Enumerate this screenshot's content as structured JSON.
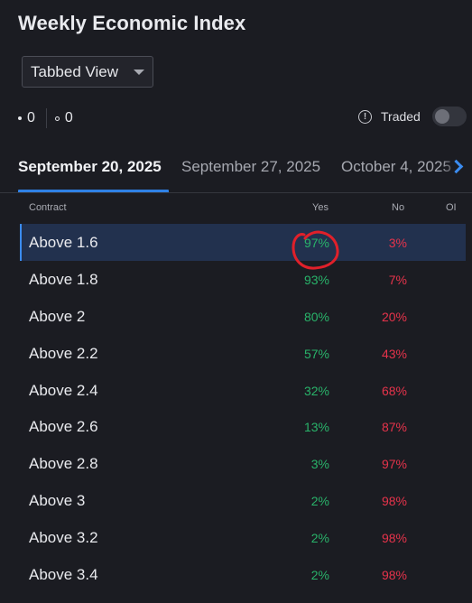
{
  "header": {
    "title": "Weekly Economic Index"
  },
  "view_select": {
    "value": "Tabbed View"
  },
  "stats": {
    "filled_count": "0",
    "hollow_count": "0"
  },
  "traded": {
    "label": "Traded",
    "info_icon": "info-circle-icon",
    "enabled": false
  },
  "tabs": [
    {
      "label": "September 20, 2025",
      "active": true
    },
    {
      "label": "September 27, 2025",
      "active": false
    },
    {
      "label": "October 4, 2025",
      "active": false
    }
  ],
  "table": {
    "headers": {
      "contract": "Contract",
      "yes": "Yes",
      "no": "No",
      "oi": "OI"
    },
    "rows": [
      {
        "contract": "Above 1.6",
        "yes": "97%",
        "no": "3%",
        "selected": true
      },
      {
        "contract": "Above 1.8",
        "yes": "93%",
        "no": "7%"
      },
      {
        "contract": "Above 2",
        "yes": "80%",
        "no": "20%"
      },
      {
        "contract": "Above 2.2",
        "yes": "57%",
        "no": "43%"
      },
      {
        "contract": "Above 2.4",
        "yes": "32%",
        "no": "68%"
      },
      {
        "contract": "Above 2.6",
        "yes": "13%",
        "no": "87%"
      },
      {
        "contract": "Above 2.8",
        "yes": "3%",
        "no": "97%"
      },
      {
        "contract": "Above 3",
        "yes": "2%",
        "no": "98%"
      },
      {
        "contract": "Above 3.2",
        "yes": "2%",
        "no": "98%"
      },
      {
        "contract": "Above 3.4",
        "yes": "2%",
        "no": "98%"
      }
    ]
  },
  "colors": {
    "background": "#1b1c22",
    "accent": "#2f81e6",
    "yes": "#29b36a",
    "no": "#e6334b",
    "selected_row": "#22314e",
    "annotation": "#e0202a"
  }
}
